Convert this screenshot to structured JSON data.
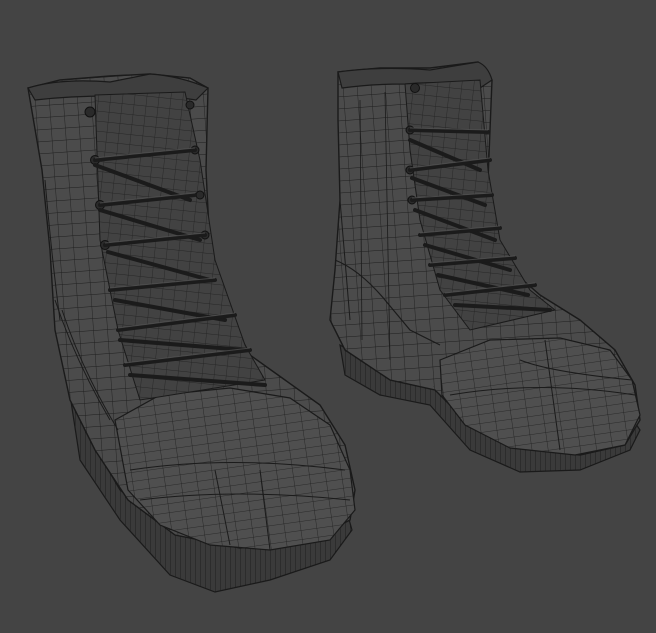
{
  "scene": {
    "background_color": "#444444",
    "wire_color": "#1c1c1c",
    "fill_color": "#4d4d4d",
    "shade_color": "#3f3f3f",
    "objects": [
      {
        "name": "left-boot-wireframe",
        "kind": "boot 3d wireframe mesh"
      },
      {
        "name": "right-boot-wireframe",
        "kind": "boot 3d wireframe mesh"
      }
    ]
  }
}
